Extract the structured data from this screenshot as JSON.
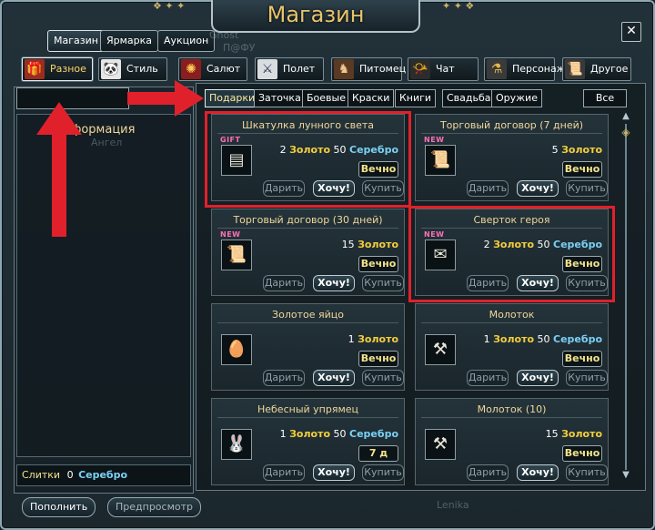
{
  "window": {
    "title": "Магазин"
  },
  "top_tabs": [
    {
      "label": "Магазин",
      "active": true
    },
    {
      "label": "Ярмарка",
      "active": false
    },
    {
      "label": "Аукцион",
      "active": false
    }
  ],
  "categories": [
    {
      "label": "Разное",
      "icon": "gift-icon",
      "active": true
    },
    {
      "label": "Стиль",
      "icon": "panda-icon",
      "active": false
    },
    {
      "label": "Салют",
      "icon": "firework-icon",
      "active": false
    },
    {
      "label": "Полет",
      "icon": "sword-icon",
      "active": false
    },
    {
      "label": "Питомец",
      "icon": "horse-icon",
      "active": false
    },
    {
      "label": "Чат",
      "icon": "horn-icon",
      "active": false
    },
    {
      "label": "Персонаж",
      "icon": "potion-icon",
      "active": false
    },
    {
      "label": "Другое",
      "icon": "scroll-icon",
      "active": false
    }
  ],
  "sub_tabs": [
    {
      "label": "Подарки",
      "active": true
    },
    {
      "label": "Заточка",
      "active": false
    },
    {
      "label": "Боевые",
      "active": false
    },
    {
      "label": "Краски",
      "active": false
    },
    {
      "label": "Книги",
      "active": false
    },
    {
      "label": "Свадьба",
      "active": false
    },
    {
      "label": "Оружие",
      "active": false
    }
  ],
  "all_button": "Все",
  "info": {
    "title": "Информация",
    "ghost_top": "Ghost",
    "ghost_lines": [
      "Ангел",
      "П@ФУ",
      "Lenika"
    ]
  },
  "search": {
    "value": ""
  },
  "currency": {
    "ingots_label": "Слитки",
    "amount": "0",
    "unit": "Серебро"
  },
  "bottom_buttons": {
    "topup": "Пополнить",
    "preview": "Предпросмотр"
  },
  "currency_words": {
    "gold": "Золото",
    "silver": "Серебро"
  },
  "card_buttons": {
    "gift": "Дарить",
    "want": "Хочу!",
    "buy": "Купить"
  },
  "items": [
    {
      "name": "Шкатулка лунного света",
      "badge": "GIFT",
      "gold": "2",
      "silver": "50",
      "duration": "Вечно",
      "icon": "chest-icon",
      "highlighted": true
    },
    {
      "name": "Торговый договор (7 дней)",
      "badge": "NEW",
      "gold": "5",
      "silver": "",
      "duration": "Вечно",
      "icon": "contract-icon",
      "highlighted": false
    },
    {
      "name": "Торговый договор (30 дней)",
      "badge": "NEW",
      "gold": "15",
      "silver": "",
      "duration": "Вечно",
      "icon": "contract-icon",
      "highlighted": false
    },
    {
      "name": "Сверток героя",
      "badge": "NEW",
      "gold": "2",
      "silver": "50",
      "duration": "Вечно",
      "icon": "bundle-icon",
      "highlighted": true
    },
    {
      "name": "Золотое яйцо",
      "badge": "",
      "gold": "1",
      "silver": "",
      "duration": "Вечно",
      "icon": "egg-icon",
      "highlighted": false
    },
    {
      "name": "Молоток",
      "badge": "",
      "gold": "1",
      "silver": "50",
      "duration": "Вечно",
      "icon": "hammer-icon",
      "highlighted": false
    },
    {
      "name": "Небесный упрямец",
      "badge": "",
      "gold": "1",
      "silver": "50",
      "duration": "7 д",
      "icon": "mount-icon",
      "highlighted": false
    },
    {
      "name": "Молоток (10)",
      "badge": "",
      "gold": "15",
      "silver": "",
      "duration": "Вечно",
      "icon": "hammer-icon",
      "highlighted": false
    }
  ]
}
